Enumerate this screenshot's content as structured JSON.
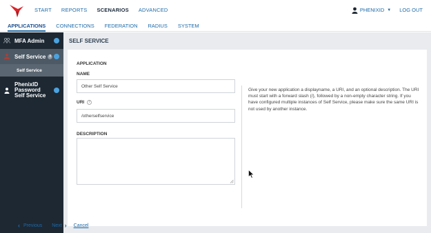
{
  "topnav": {
    "items": [
      {
        "label": "START",
        "active": false
      },
      {
        "label": "REPORTS",
        "active": false
      },
      {
        "label": "SCENARIOS",
        "active": true
      },
      {
        "label": "ADVANCED",
        "active": false
      }
    ],
    "user_label": "PHENIXID",
    "logout_label": "LOG OUT"
  },
  "subnav": {
    "items": [
      {
        "label": "APPLICATIONS",
        "active": true
      },
      {
        "label": "CONNECTIONS",
        "active": false
      },
      {
        "label": "FEDERATION",
        "active": false
      },
      {
        "label": "RADIUS",
        "active": false
      },
      {
        "label": "SYSTEM",
        "active": false
      }
    ]
  },
  "sidebar": {
    "mfa_label": "MFA Admin",
    "self_service_label": "Self Service",
    "self_service_badge": "8",
    "self_service_sub": "Self Service",
    "password_line1": "PhenixID",
    "password_line2": "Password",
    "password_line3": "Self Service"
  },
  "main": {
    "header": "SELF SERVICE",
    "section_title": "APPLICATION",
    "name_label": "NAME",
    "name_value": "Other Self Service",
    "uri_label": "URI",
    "uri_help": "?",
    "uri_value": "/otherselfservice",
    "description_label": "DESCRIPTION",
    "help_text": "Give your new application a displayname, a URI, and an optional description. The URI must start with a forward slash (/), followed by a non-empty character string. If you have configured multiple instances of Self Service, please make sure the same URI is not used by another instance."
  },
  "footer": {
    "previous_label": "Previous",
    "next_label": "Next",
    "cancel_label": "Cancel"
  },
  "colors": {
    "accent": "#1d6aa8",
    "sidebar_bg": "#1d2833",
    "sidebar_active": "#4d5a66",
    "badge_dot": "#4aa3e0",
    "logo_red": "#d9262b"
  }
}
